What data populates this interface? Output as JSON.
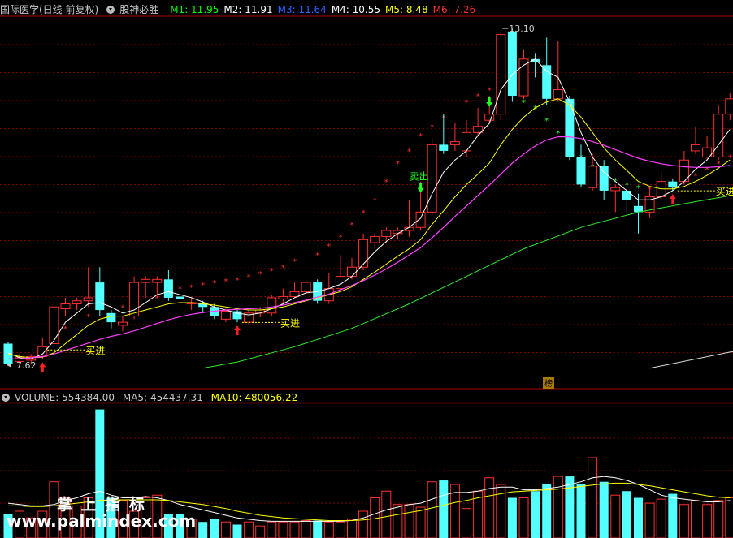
{
  "header": {
    "title": "国际医学(日线 前复权)",
    "indicator": "股神必胜",
    "ma": [
      {
        "label": "M1:",
        "value": "11.95",
        "color": "#00ff00"
      },
      {
        "label": "M2:",
        "value": "11.91",
        "color": "#ffffff"
      },
      {
        "label": "M3:",
        "value": "11.64",
        "color": "#3060ff"
      },
      {
        "label": "M4:",
        "value": "10.55",
        "color": "#ffffff"
      },
      {
        "label": "M5:",
        "value": "8.48",
        "color": "#ffff00"
      },
      {
        "label": "M6:",
        "value": "7.26",
        "color": "#ff3030"
      }
    ]
  },
  "volume_header": {
    "label": "VOLUME:",
    "value": "554384.00",
    "ma5_label": "MA5:",
    "ma5": "454437.31",
    "ma10_label": "MA10:",
    "ma10": "480056.22"
  },
  "annotations": {
    "buy": "买进",
    "sell": "卖出",
    "high": "13.10",
    "low": "7.62",
    "badge": "榜"
  },
  "watermark": {
    "cn": "掌 上 指 标",
    "url": "www.palmindex.com"
  },
  "colors": {
    "up": "#ff3030",
    "down": "#54ffff",
    "ma_white": "#ffffff",
    "ma_yellow": "#ffff00",
    "ma_magenta": "#ff40ff",
    "ma_green": "#30e830",
    "grid": "#7a0000"
  },
  "chart_data": {
    "type": "candlestick",
    "price_range": [
      7.4,
      13.3
    ],
    "candles": [
      {
        "o": 7.95,
        "c": 7.62,
        "h": 7.98,
        "l": 7.6
      },
      {
        "o": 7.66,
        "c": 7.72,
        "h": 7.78,
        "l": 7.58
      },
      {
        "o": 7.68,
        "c": 7.74,
        "h": 7.78,
        "l": 7.62
      },
      {
        "o": 7.74,
        "c": 7.9,
        "h": 8.05,
        "l": 7.7
      },
      {
        "o": 7.95,
        "c": 8.55,
        "h": 8.65,
        "l": 7.9
      },
      {
        "o": 8.52,
        "c": 8.6,
        "h": 8.7,
        "l": 8.4
      },
      {
        "o": 8.6,
        "c": 8.65,
        "h": 8.7,
        "l": 8.5
      },
      {
        "o": 8.65,
        "c": 8.7,
        "h": 9.2,
        "l": 8.55
      },
      {
        "o": 8.95,
        "c": 8.5,
        "h": 9.2,
        "l": 8.4
      },
      {
        "o": 8.45,
        "c": 8.3,
        "h": 8.5,
        "l": 8.2
      },
      {
        "o": 8.25,
        "c": 8.3,
        "h": 8.4,
        "l": 8.15
      },
      {
        "o": 8.4,
        "c": 8.95,
        "h": 9.05,
        "l": 8.35
      },
      {
        "o": 8.95,
        "c": 9.0,
        "h": 9.05,
        "l": 8.7
      },
      {
        "o": 8.95,
        "c": 9.0,
        "h": 9.05,
        "l": 8.75
      },
      {
        "o": 9.0,
        "c": 8.7,
        "h": 9.15,
        "l": 8.65
      },
      {
        "o": 8.72,
        "c": 8.68,
        "h": 8.75,
        "l": 8.55
      },
      {
        "o": 8.6,
        "c": 8.62,
        "h": 8.7,
        "l": 8.5
      },
      {
        "o": 8.62,
        "c": 8.55,
        "h": 8.65,
        "l": 8.45
      },
      {
        "o": 8.55,
        "c": 8.4,
        "h": 8.6,
        "l": 8.35
      },
      {
        "o": 8.35,
        "c": 8.48,
        "h": 8.52,
        "l": 8.3
      },
      {
        "o": 8.48,
        "c": 8.35,
        "h": 8.5,
        "l": 8.3
      },
      {
        "o": 8.3,
        "c": 8.45,
        "h": 8.5,
        "l": 8.25
      },
      {
        "o": 8.45,
        "c": 8.5,
        "h": 8.55,
        "l": 8.38
      },
      {
        "o": 8.45,
        "c": 8.7,
        "h": 8.75,
        "l": 8.4
      },
      {
        "o": 8.68,
        "c": 8.72,
        "h": 8.85,
        "l": 8.6
      },
      {
        "o": 8.72,
        "c": 8.8,
        "h": 8.95,
        "l": 8.7
      },
      {
        "o": 8.8,
        "c": 8.95,
        "h": 9.0,
        "l": 8.75
      },
      {
        "o": 8.95,
        "c": 8.65,
        "h": 9.0,
        "l": 8.6
      },
      {
        "o": 8.65,
        "c": 8.85,
        "h": 9.1,
        "l": 8.6
      },
      {
        "o": 8.85,
        "c": 9.05,
        "h": 9.4,
        "l": 8.8
      },
      {
        "o": 9.05,
        "c": 9.2,
        "h": 9.35,
        "l": 9.0
      },
      {
        "o": 9.2,
        "c": 9.65,
        "h": 9.75,
        "l": 9.15
      },
      {
        "o": 9.6,
        "c": 9.7,
        "h": 9.75,
        "l": 9.5
      },
      {
        "o": 9.7,
        "c": 9.8,
        "h": 9.85,
        "l": 9.6
      },
      {
        "o": 9.75,
        "c": 9.8,
        "h": 9.85,
        "l": 9.65
      },
      {
        "o": 9.8,
        "c": 9.85,
        "h": 10.3,
        "l": 9.7
      },
      {
        "o": 9.85,
        "c": 10.1,
        "h": 10.6,
        "l": 9.8
      },
      {
        "o": 10.1,
        "c": 11.2,
        "h": 11.3,
        "l": 10.05
      },
      {
        "o": 11.2,
        "c": 11.1,
        "h": 11.7,
        "l": 11.05
      },
      {
        "o": 11.2,
        "c": 11.25,
        "h": 11.55,
        "l": 11.1
      },
      {
        "o": 11.1,
        "c": 11.4,
        "h": 11.6,
        "l": 11.0
      },
      {
        "o": 11.4,
        "c": 11.5,
        "h": 11.8,
        "l": 11.35
      },
      {
        "o": 11.6,
        "c": 11.7,
        "h": 12.0,
        "l": 11.55
      },
      {
        "o": 11.7,
        "c": 13.0,
        "h": 13.05,
        "l": 11.6
      },
      {
        "o": 13.05,
        "c": 12.0,
        "h": 13.1,
        "l": 11.9
      },
      {
        "o": 12.0,
        "c": 12.6,
        "h": 12.75,
        "l": 11.95
      },
      {
        "o": 12.6,
        "c": 12.55,
        "h": 12.7,
        "l": 12.3
      },
      {
        "o": 12.5,
        "c": 11.95,
        "h": 12.95,
        "l": 11.85
      },
      {
        "o": 11.95,
        "c": 12.1,
        "h": 12.9,
        "l": 11.9
      },
      {
        "o": 11.95,
        "c": 11.0,
        "h": 12.0,
        "l": 10.95
      },
      {
        "o": 11.0,
        "c": 10.55,
        "h": 11.2,
        "l": 10.5
      },
      {
        "o": 10.5,
        "c": 10.85,
        "h": 11.05,
        "l": 10.45
      },
      {
        "o": 10.85,
        "c": 10.45,
        "h": 10.95,
        "l": 10.3
      },
      {
        "o": 10.45,
        "c": 10.5,
        "h": 10.55,
        "l": 10.1
      },
      {
        "o": 10.45,
        "c": 10.3,
        "h": 10.5,
        "l": 10.1
      },
      {
        "o": 10.2,
        "c": 10.1,
        "h": 10.4,
        "l": 9.75
      },
      {
        "o": 10.1,
        "c": 10.35,
        "h": 10.5,
        "l": 10.0
      },
      {
        "o": 10.35,
        "c": 10.6,
        "h": 10.75,
        "l": 10.3
      },
      {
        "o": 10.6,
        "c": 10.5,
        "h": 10.65,
        "l": 10.45
      },
      {
        "o": 10.6,
        "c": 10.95,
        "h": 11.1,
        "l": 10.55
      },
      {
        "o": 11.1,
        "c": 11.2,
        "h": 11.5,
        "l": 11.05
      },
      {
        "o": 11.0,
        "c": 11.15,
        "h": 11.35,
        "l": 10.95
      },
      {
        "o": 11.0,
        "c": 11.7,
        "h": 11.85,
        "l": 10.95
      },
      {
        "o": 11.7,
        "c": 11.95,
        "h": 12.05,
        "l": 11.6
      }
    ],
    "ma_white": [
      7.8,
      7.72,
      7.7,
      7.78,
      8.0,
      8.3,
      8.45,
      8.6,
      8.62,
      8.55,
      8.45,
      8.5,
      8.62,
      8.75,
      8.8,
      8.75,
      8.7,
      8.63,
      8.55,
      8.5,
      8.45,
      8.42,
      8.45,
      8.52,
      8.6,
      8.7,
      8.78,
      8.8,
      8.85,
      8.92,
      9.05,
      9.25,
      9.45,
      9.62,
      9.75,
      9.85,
      10.0,
      10.4,
      10.75,
      10.95,
      11.1,
      11.35,
      11.55,
      12.1,
      12.35,
      12.5,
      12.6,
      12.4,
      12.3,
      11.9,
      11.4,
      11.0,
      10.75,
      10.6,
      10.45,
      10.3,
      10.3,
      10.35,
      10.45,
      10.6,
      10.8,
      10.95,
      11.2,
      11.45
    ],
    "ma_yellow": [
      7.78,
      7.74,
      7.72,
      7.73,
      7.8,
      7.95,
      8.1,
      8.25,
      8.35,
      8.4,
      8.4,
      8.45,
      8.5,
      8.55,
      8.6,
      8.62,
      8.62,
      8.6,
      8.58,
      8.55,
      8.52,
      8.5,
      8.5,
      8.52,
      8.55,
      8.6,
      8.65,
      8.7,
      8.75,
      8.8,
      8.88,
      9.0,
      9.12,
      9.25,
      9.38,
      9.5,
      9.65,
      9.9,
      10.12,
      10.35,
      10.55,
      10.72,
      10.9,
      11.2,
      11.45,
      11.65,
      11.8,
      11.9,
      11.95,
      11.85,
      11.65,
      11.4,
      11.15,
      10.95,
      10.78,
      10.6,
      10.52,
      10.48,
      10.48,
      10.52,
      10.6,
      10.7,
      10.82,
      10.95
    ],
    "ma_magenta": [
      7.7,
      7.7,
      7.72,
      7.74,
      7.78,
      7.84,
      7.9,
      7.96,
      8.02,
      8.07,
      8.11,
      8.16,
      8.22,
      8.28,
      8.34,
      8.39,
      8.43,
      8.46,
      8.48,
      8.5,
      8.51,
      8.52,
      8.53,
      8.55,
      8.58,
      8.62,
      8.66,
      8.71,
      8.76,
      8.83,
      8.9,
      8.98,
      9.07,
      9.17,
      9.28,
      9.4,
      9.52,
      9.68,
      9.85,
      10.03,
      10.2,
      10.37,
      10.54,
      10.72,
      10.9,
      11.05,
      11.18,
      11.28,
      11.33,
      11.33,
      11.3,
      11.25,
      11.19,
      11.12,
      11.05,
      10.98,
      10.93,
      10.89,
      10.86,
      10.84,
      10.83,
      10.83,
      10.84,
      10.86
    ],
    "ma_green": [
      [
        17,
        7.55
      ],
      [
        20,
        7.65
      ],
      [
        25,
        7.9
      ],
      [
        30,
        8.2
      ],
      [
        35,
        8.6
      ],
      [
        40,
        9.05
      ],
      [
        45,
        9.5
      ],
      [
        50,
        9.85
      ],
      [
        55,
        10.1
      ],
      [
        60,
        10.27
      ],
      [
        64,
        10.4
      ]
    ],
    "ma_far": [
      [
        56,
        7.55
      ],
      [
        64,
        7.85
      ]
    ],
    "stars": [
      [
        5,
        8.2
      ],
      [
        7,
        8.4
      ],
      [
        8,
        8.5
      ],
      [
        10,
        8.55
      ],
      [
        11,
        8.65
      ],
      [
        13,
        8.7
      ],
      [
        14,
        8.8
      ],
      [
        15,
        8.85
      ],
      [
        16,
        8.88
      ],
      [
        17,
        8.92
      ],
      [
        18,
        8.95
      ],
      [
        19,
        8.98
      ],
      [
        20,
        9.0
      ],
      [
        21,
        9.05
      ],
      [
        22,
        9.1
      ],
      [
        23,
        9.15
      ],
      [
        24,
        9.2
      ],
      [
        25,
        9.3
      ],
      [
        27,
        9.4
      ],
      [
        28,
        9.55
      ],
      [
        29,
        9.7
      ],
      [
        30,
        9.9
      ],
      [
        31,
        10.1
      ],
      [
        32,
        10.3
      ],
      [
        33,
        10.6
      ],
      [
        34,
        10.9
      ],
      [
        35,
        11.1
      ],
      [
        36,
        11.35
      ],
      [
        37,
        11.5
      ],
      [
        38,
        11.65
      ],
      [
        40,
        11.9
      ],
      [
        41,
        12.0
      ],
      [
        42,
        12.1
      ],
      [
        43,
        12.2
      ],
      [
        44,
        12.1
      ],
      [
        45,
        11.9
      ],
      [
        46,
        11.8
      ],
      [
        47,
        11.6
      ],
      [
        48,
        11.4
      ],
      [
        49,
        11.2
      ],
      [
        50,
        11.0
      ],
      [
        51,
        10.85
      ],
      [
        52,
        10.72
      ],
      [
        53,
        10.62
      ],
      [
        54,
        10.55
      ],
      [
        55,
        10.5
      ],
      [
        56,
        10.48
      ],
      [
        57,
        10.5
      ],
      [
        58,
        10.55
      ],
      [
        59,
        10.6
      ],
      [
        60,
        10.7
      ],
      [
        61,
        10.8
      ],
      [
        62,
        10.9
      ],
      [
        63,
        11.0
      ]
    ],
    "buy_signals": [
      3,
      20,
      58
    ],
    "sell_signals": [
      36,
      42
    ],
    "volume": {
      "range": [
        0,
        1000000
      ],
      "values": [
        180000,
        200000,
        150000,
        200000,
        420000,
        300000,
        240000,
        300000,
        960000,
        300000,
        280000,
        200000,
        300000,
        320000,
        180000,
        180000,
        140000,
        120000,
        140000,
        120000,
        100000,
        120000,
        90000,
        120000,
        120000,
        120000,
        130000,
        130000,
        120000,
        120000,
        140000,
        200000,
        300000,
        350000,
        250000,
        250000,
        230000,
        420000,
        430000,
        400000,
        220000,
        350000,
        450000,
        400000,
        300000,
        300000,
        350000,
        400000,
        460000,
        460000,
        400000,
        600000,
        420000,
        320000,
        350000,
        300000,
        260000,
        290000,
        330000,
        250000,
        280000,
        250000,
        280000,
        300000
      ],
      "ma5": [
        260000,
        250000,
        240000,
        240000,
        250000,
        280000,
        300000,
        330000,
        350000,
        320000,
        300000,
        300000,
        310000,
        300000,
        280000,
        250000,
        230000,
        210000,
        190000,
        170000,
        150000,
        140000,
        130000,
        125000,
        125000,
        125000,
        125000,
        125000,
        125000,
        126000,
        130000,
        150000,
        180000,
        210000,
        230000,
        250000,
        260000,
        290000,
        320000,
        340000,
        340000,
        350000,
        370000,
        380000,
        380000,
        360000,
        360000,
        370000,
        380000,
        400000,
        420000,
        450000,
        460000,
        450000,
        430000,
        400000,
        360000,
        320000,
        300000,
        290000,
        280000,
        270000,
        270000,
        280000
      ],
      "ma10": [
        240000,
        240000,
        235000,
        235000,
        240000,
        250000,
        260000,
        270000,
        280000,
        285000,
        285000,
        285000,
        285000,
        285000,
        280000,
        270000,
        260000,
        250000,
        235000,
        220000,
        200000,
        185000,
        170000,
        160000,
        150000,
        145000,
        140000,
        135000,
        130000,
        130000,
        130000,
        135000,
        145000,
        160000,
        175000,
        190000,
        205000,
        225000,
        245000,
        265000,
        280000,
        300000,
        315000,
        330000,
        345000,
        350000,
        355000,
        360000,
        365000,
        375000,
        385000,
        395000,
        405000,
        410000,
        410000,
        400000,
        390000,
        375000,
        360000,
        345000,
        330000,
        315000,
        305000,
        300000
      ]
    }
  }
}
